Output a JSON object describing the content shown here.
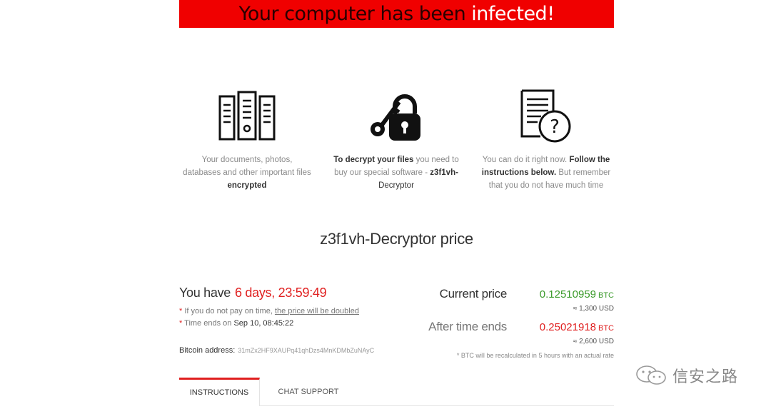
{
  "banner": {
    "prefix": "Your computer has been",
    "highlight": "infected!"
  },
  "features": [
    {
      "icon": "server-files-icon",
      "lines": [
        "Your documents, photos,",
        "databases and other important files",
        "encrypted"
      ]
    },
    {
      "icon": "key-lock-icon",
      "lines": [
        "To decrypt your files you need to",
        "buy our special software - z3f1vh-",
        "Decryptor"
      ]
    },
    {
      "icon": "document-question-icon",
      "lines": [
        "You can do it right now. Follow the",
        "instructions below. But remember",
        "that you do not have much time"
      ]
    }
  ],
  "price_title": "z3f1vh-Decryptor price",
  "timer": {
    "label": "You have",
    "value": "6 days, 23:59:49",
    "note_prefix": "If you do not pay on time,",
    "note_link": "the price will be doubled",
    "time_ends_label": "Time ends on",
    "time_ends_value": "Sep 10, 08:45:22"
  },
  "bitcoin": {
    "label": "Bitcoin address:",
    "address": "31mZx2HF9XAUPq41qhDzs4MnKDMbZuNAyC"
  },
  "prices": {
    "current": {
      "label": "Current price",
      "btc": "0.12510959",
      "unit": "BTC",
      "usd": "≈ 1,300 USD"
    },
    "after": {
      "label": "After time ends",
      "btc": "0.25021918",
      "unit": "BTC",
      "usd": "≈ 2,600 USD"
    },
    "recalc_note": "* BTC will be recalculated in 5 hours with an actual rate"
  },
  "tabs": [
    {
      "label": "INSTRUCTIONS",
      "active": true
    },
    {
      "label": "CHAT SUPPORT",
      "active": false
    }
  ],
  "watermark": {
    "text": "信安之路",
    "icon": "wechat-icon"
  },
  "colors": {
    "banner": "#f00000",
    "accent_red": "#e02020",
    "price_green": "#3a9a2a"
  }
}
